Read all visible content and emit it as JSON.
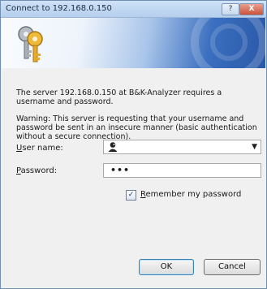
{
  "window": {
    "title": "Connect to 192.168.0.150",
    "help_label": "?",
    "close_label": "X"
  },
  "icons": {
    "banner": "keys-icon",
    "user_combo": "user-account-icon",
    "dropdown": "chevron-down-icon"
  },
  "message": {
    "line1": "The server 192.168.0.150 at B&K-Analyzer requires a username and password.",
    "warning": "Warning: This server is requesting that your username and password be sent in an insecure manner (basic authentication without a secure connection)."
  },
  "form": {
    "username_label_accel": "U",
    "username_label_rest": "ser name:",
    "password_label_accel": "P",
    "password_label_rest": "assword:",
    "username_value": "",
    "password_mask": "•••",
    "remember_checked": true,
    "remember_label_accel": "R",
    "remember_label_rest": "emember my password"
  },
  "buttons": {
    "ok": "OK",
    "cancel": "Cancel"
  },
  "colors": {
    "banner_blue": "#2a58a8",
    "titlebar": "#b5cfee"
  }
}
